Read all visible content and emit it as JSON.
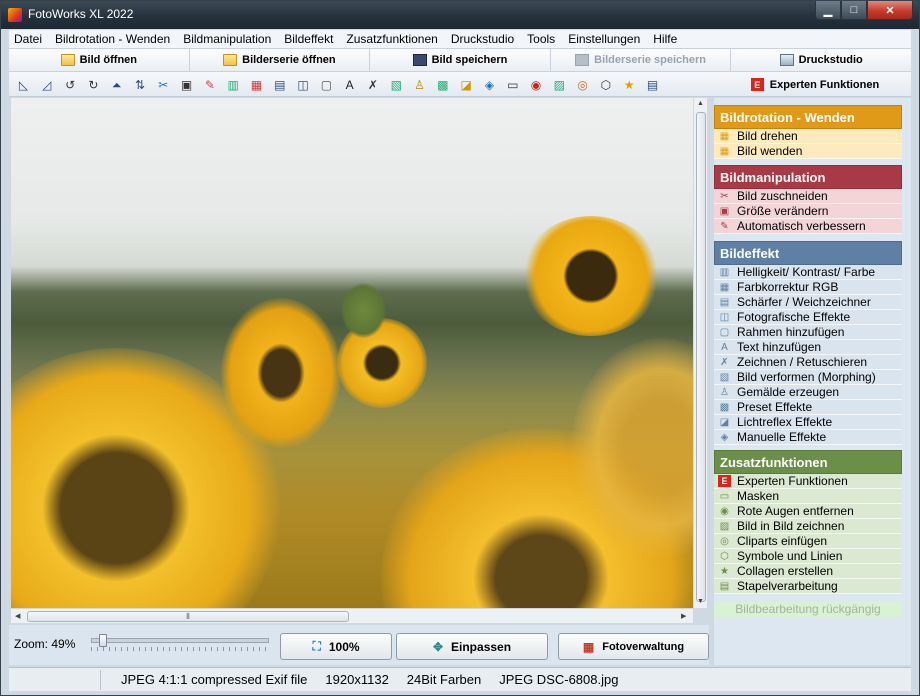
{
  "window": {
    "title": "FotoWorks XL 2022",
    "controls": {
      "minimize": "▁",
      "maximize": "□",
      "close": "✕"
    }
  },
  "menu": [
    "Datei",
    "Bildrotation - Wenden",
    "Bildmanipulation",
    "Bildeffekt",
    "Zusatzfunktionen",
    "Druckstudio",
    "Tools",
    "Einstellungen",
    "Hilfe"
  ],
  "buttonbar": {
    "open": "Bild öffnen",
    "open_series": "Bilderserie öffnen",
    "save": "Bild speichern",
    "save_series": "Bilderserie speichern",
    "print": "Druckstudio"
  },
  "toolbar": {
    "icons": [
      "rotate-left-icon",
      "rotate-right-icon",
      "rotate-ccw-icon",
      "rotate-cw-icon",
      "flip-vertical-icon",
      "flip-horizontal-icon",
      "crop-icon",
      "resize-icon",
      "magic-wand-icon",
      "levels-icon",
      "color-icon",
      "sharpen-icon",
      "effects-icon",
      "frame-icon",
      "text-icon",
      "draw-icon",
      "morph-icon",
      "paint-icon",
      "preset-icon",
      "lensflare-icon",
      "manual-effect-icon",
      "mask-icon",
      "red-eye-icon",
      "picture-in-picture-icon",
      "clipart-icon",
      "symbol-icon",
      "star-icon",
      "batch-icon"
    ],
    "glyphs": [
      "◺",
      "◿",
      "↺",
      "↻",
      "⏶",
      "⇅",
      "✂",
      "▣",
      "✎",
      "▥",
      "▦",
      "▤",
      "◫",
      "▢",
      "A",
      "✗",
      "▧",
      "♙",
      "▩",
      "◪",
      "◈",
      "▭",
      "◉",
      "▨",
      "◎",
      "⬡",
      "★",
      "▤"
    ],
    "expert_badge": "E",
    "expert_label": "Experten Funktionen"
  },
  "panel": {
    "sections": [
      {
        "title": "Bildrotation - Wenden",
        "color": "#e09a17",
        "items_bg": "#fdebbd",
        "items": [
          {
            "label": "Bild drehen",
            "glyph": "▦"
          },
          {
            "label": "Bild wenden",
            "glyph": "▦"
          }
        ]
      },
      {
        "title": "Bildmanipulation",
        "color": "#a83a46",
        "items_bg": "#f3d5d8",
        "items": [
          {
            "label": "Bild zuschneiden",
            "glyph": "✂"
          },
          {
            "label": "Größe verändern",
            "glyph": "▣"
          },
          {
            "label": "Automatisch verbessern",
            "glyph": "✎"
          }
        ]
      },
      {
        "title": "Bildeffekt",
        "color": "#5f7fa4",
        "items_bg": "#dae4ef",
        "items": [
          {
            "label": "Helligkeit/ Kontrast/ Farbe",
            "glyph": "▥"
          },
          {
            "label": "Farbkorrektur RGB",
            "glyph": "▦"
          },
          {
            "label": "Schärfer / Weichzeichner",
            "glyph": "▤"
          },
          {
            "label": "Fotografische Effekte",
            "glyph": "◫"
          },
          {
            "label": "Rahmen hinzufügen",
            "glyph": "▢"
          },
          {
            "label": "Text hinzufügen",
            "glyph": "A"
          },
          {
            "label": "Zeichnen / Retuschieren",
            "glyph": "✗"
          },
          {
            "label": "Bild verformen (Morphing)",
            "glyph": "▧"
          },
          {
            "label": "Gemälde erzeugen",
            "glyph": "♙"
          },
          {
            "label": "Preset Effekte",
            "glyph": "▩"
          },
          {
            "label": "Lichtreflex Effekte",
            "glyph": "◪"
          },
          {
            "label": "Manuelle Effekte",
            "glyph": "◈"
          }
        ]
      },
      {
        "title": "Zusatzfunktionen",
        "color": "#6b8f48",
        "items_bg": "#dbe8d2",
        "items": [
          {
            "label": "Experten Funktionen",
            "glyph": "E"
          },
          {
            "label": "Masken",
            "glyph": "▭"
          },
          {
            "label": "Rote Augen entfernen",
            "glyph": "◉"
          },
          {
            "label": "Bild in Bild zeichnen",
            "glyph": "▨"
          },
          {
            "label": "Cliparts einfügen",
            "glyph": "◎"
          },
          {
            "label": "Symbole und Linien",
            "glyph": "⬡"
          },
          {
            "label": "Collagen erstellen",
            "glyph": "★"
          },
          {
            "label": "Stapelverarbeitung",
            "glyph": "▤"
          }
        ]
      }
    ],
    "undo": "Bildbearbeitung rückgängig"
  },
  "zoom": {
    "label": "Zoom: 49%",
    "value": 49,
    "button_100": "100%",
    "button_fit": "Einpassen",
    "button_manager": "Fotoverwaltung"
  },
  "status": {
    "format": "JPEG 4:1:1 compressed Exif file",
    "dimensions": "1920x1132",
    "colors": "24Bit Farben",
    "filename": "JPEG DSC-6808.jpg"
  }
}
